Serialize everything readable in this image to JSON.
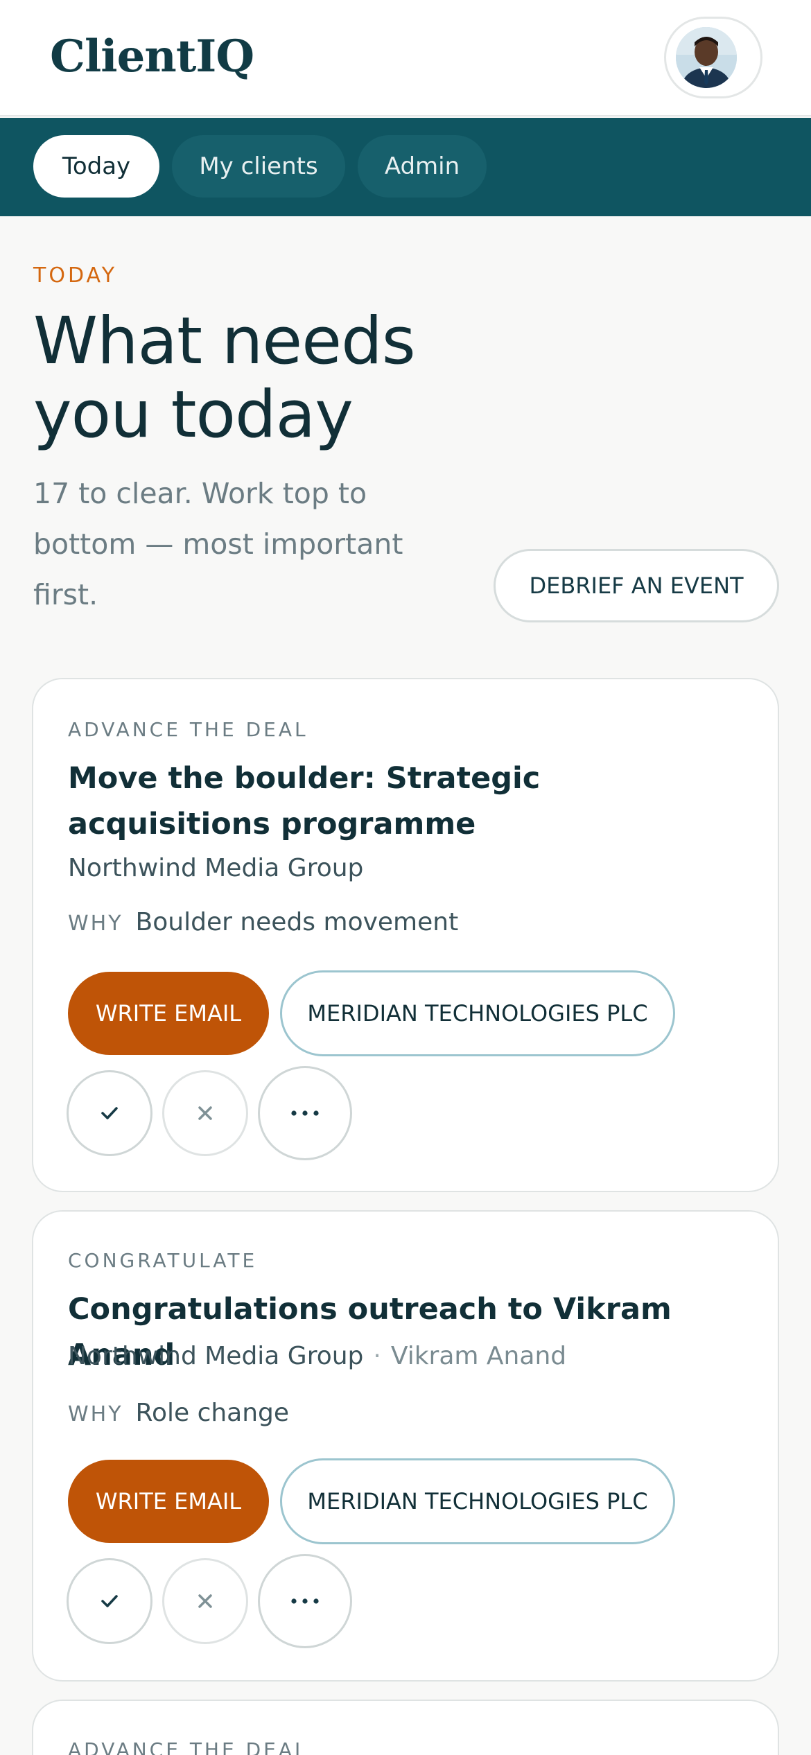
{
  "app": {
    "name": "ClientIQ"
  },
  "nav": {
    "tabs": [
      {
        "label": "Today",
        "active": true
      },
      {
        "label": "My clients",
        "active": false
      },
      {
        "label": "Admin",
        "active": false
      }
    ]
  },
  "intro": {
    "eyebrow": "TODAY",
    "title": "What needs you today",
    "subtitle": "17 to clear. Work top to bottom — most important first.",
    "debrief_label": "DEBRIEF AN EVENT"
  },
  "cards": [
    {
      "category": "ADVANCE THE DEAL",
      "title": "Move the boulder: Strategic acquisitions programme",
      "client": "Northwind Media Group",
      "contact": "",
      "why_label": "WHY",
      "why": "Boulder needs movement",
      "email_label": "WRITE EMAIL",
      "company_label": "MERIDIAN TECHNOLOGIES PLC"
    },
    {
      "category": "CONGRATULATE",
      "title": "Congratulations outreach to Vikram Anand",
      "client": "Northwind Media Group",
      "separator": "·",
      "contact": "Vikram Anand",
      "why_label": "WHY",
      "why": "Role change",
      "email_label": "WRITE EMAIL",
      "company_label": "MERIDIAN TECHNOLOGIES PLC"
    },
    {
      "category": "ADVANCE THE DEAL"
    }
  ],
  "icons": {
    "avatar": "user-photo",
    "check": "check-icon",
    "close": "close-icon",
    "more": "more-icon"
  },
  "colors": {
    "brand": "#0f5561",
    "accent": "#bf5407",
    "eyebrow": "#d4670f"
  }
}
